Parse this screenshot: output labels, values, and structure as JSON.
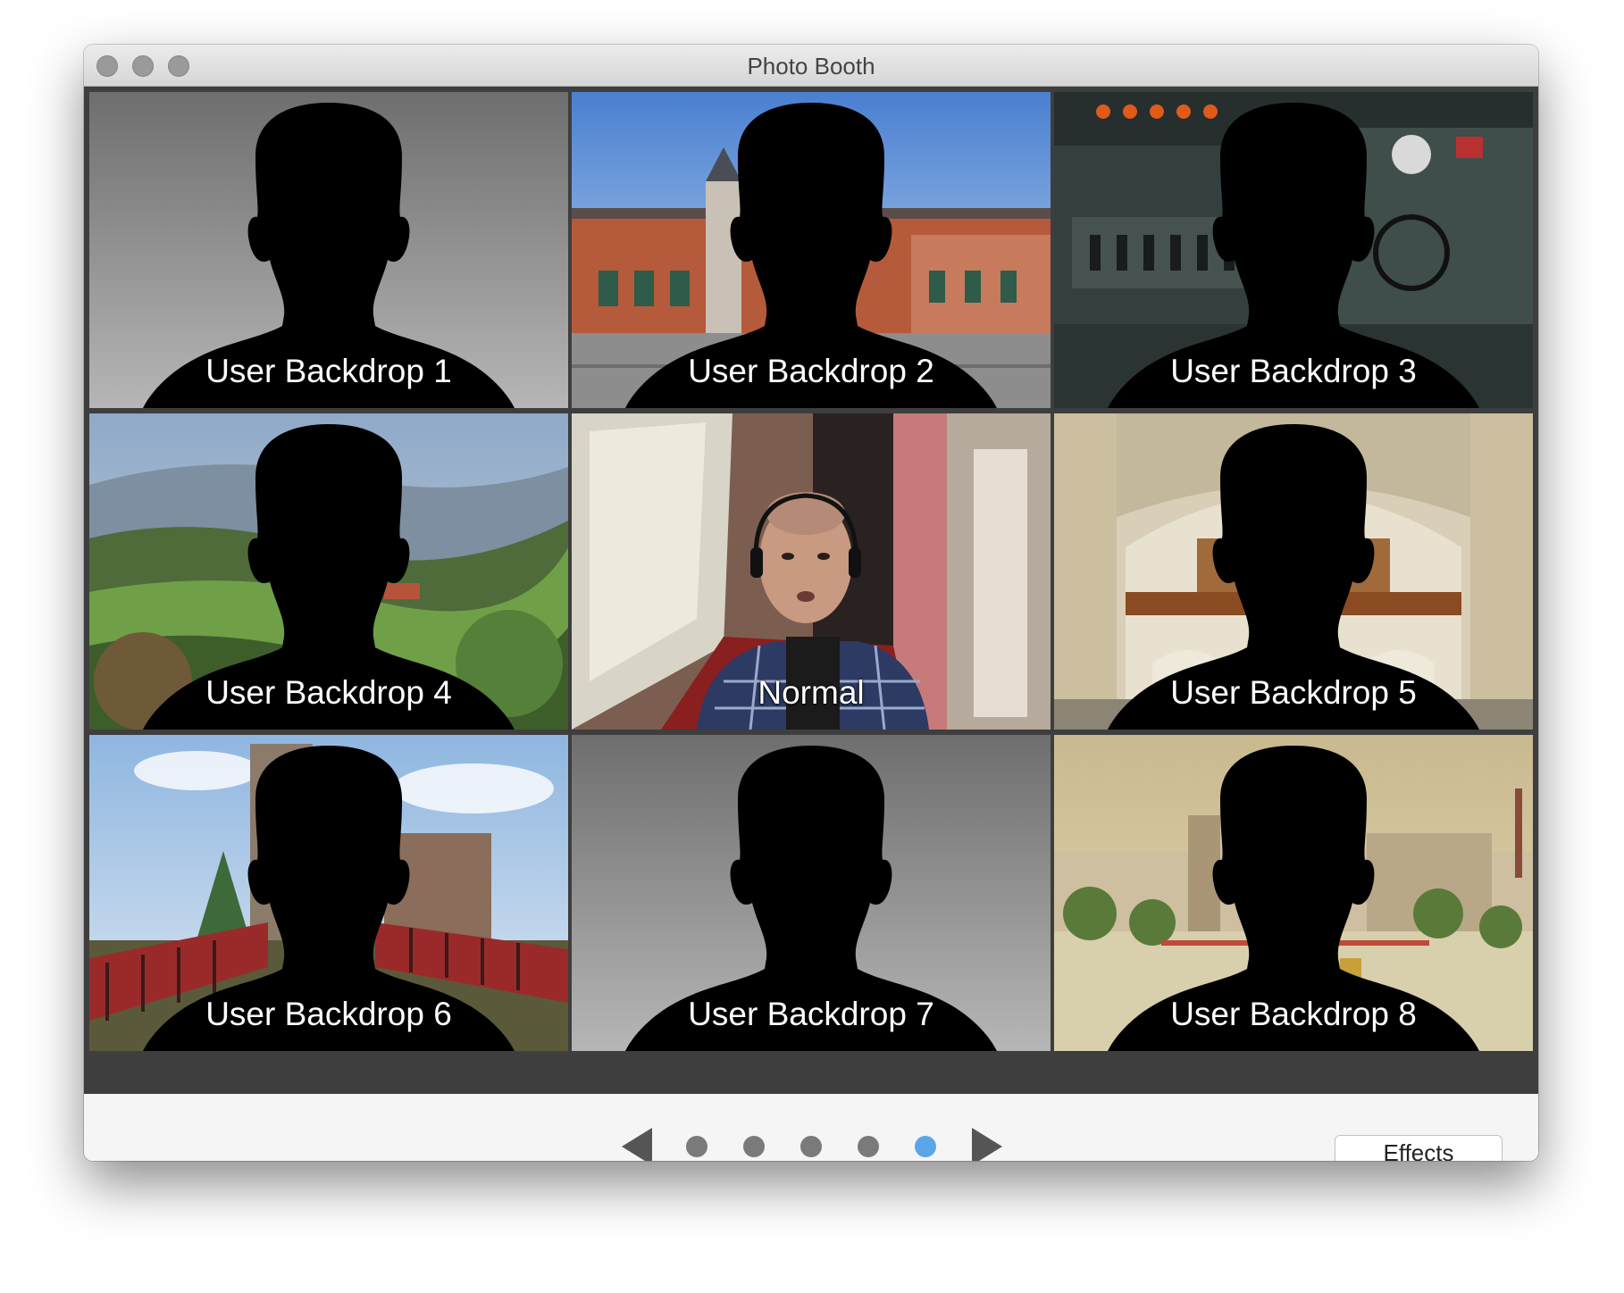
{
  "window": {
    "title": "Photo Booth"
  },
  "tiles": [
    {
      "label": "User Backdrop 1",
      "backdrop": "gray-gradient"
    },
    {
      "label": "User Backdrop 2",
      "backdrop": "station-building"
    },
    {
      "label": "User Backdrop 3",
      "backdrop": "control-panel"
    },
    {
      "label": "User Backdrop 4",
      "backdrop": "green-hills"
    },
    {
      "label": "Normal",
      "backdrop": "camera-feed"
    },
    {
      "label": "User Backdrop 5",
      "backdrop": "church-interior"
    },
    {
      "label": "User Backdrop 6",
      "backdrop": "castle-ruins"
    },
    {
      "label": "User Backdrop 7",
      "backdrop": "gray-gradient"
    },
    {
      "label": "User Backdrop 8",
      "backdrop": "vintage-postcard"
    }
  ],
  "pager": {
    "prev_icon": "triangle-left-icon",
    "next_icon": "triangle-right-icon",
    "page_count": 5,
    "active_page": 5
  },
  "effects_button": {
    "label": "Effects"
  },
  "colors": {
    "active_dot": "#5aa6e8",
    "inactive_dot": "#7a7a7a"
  }
}
